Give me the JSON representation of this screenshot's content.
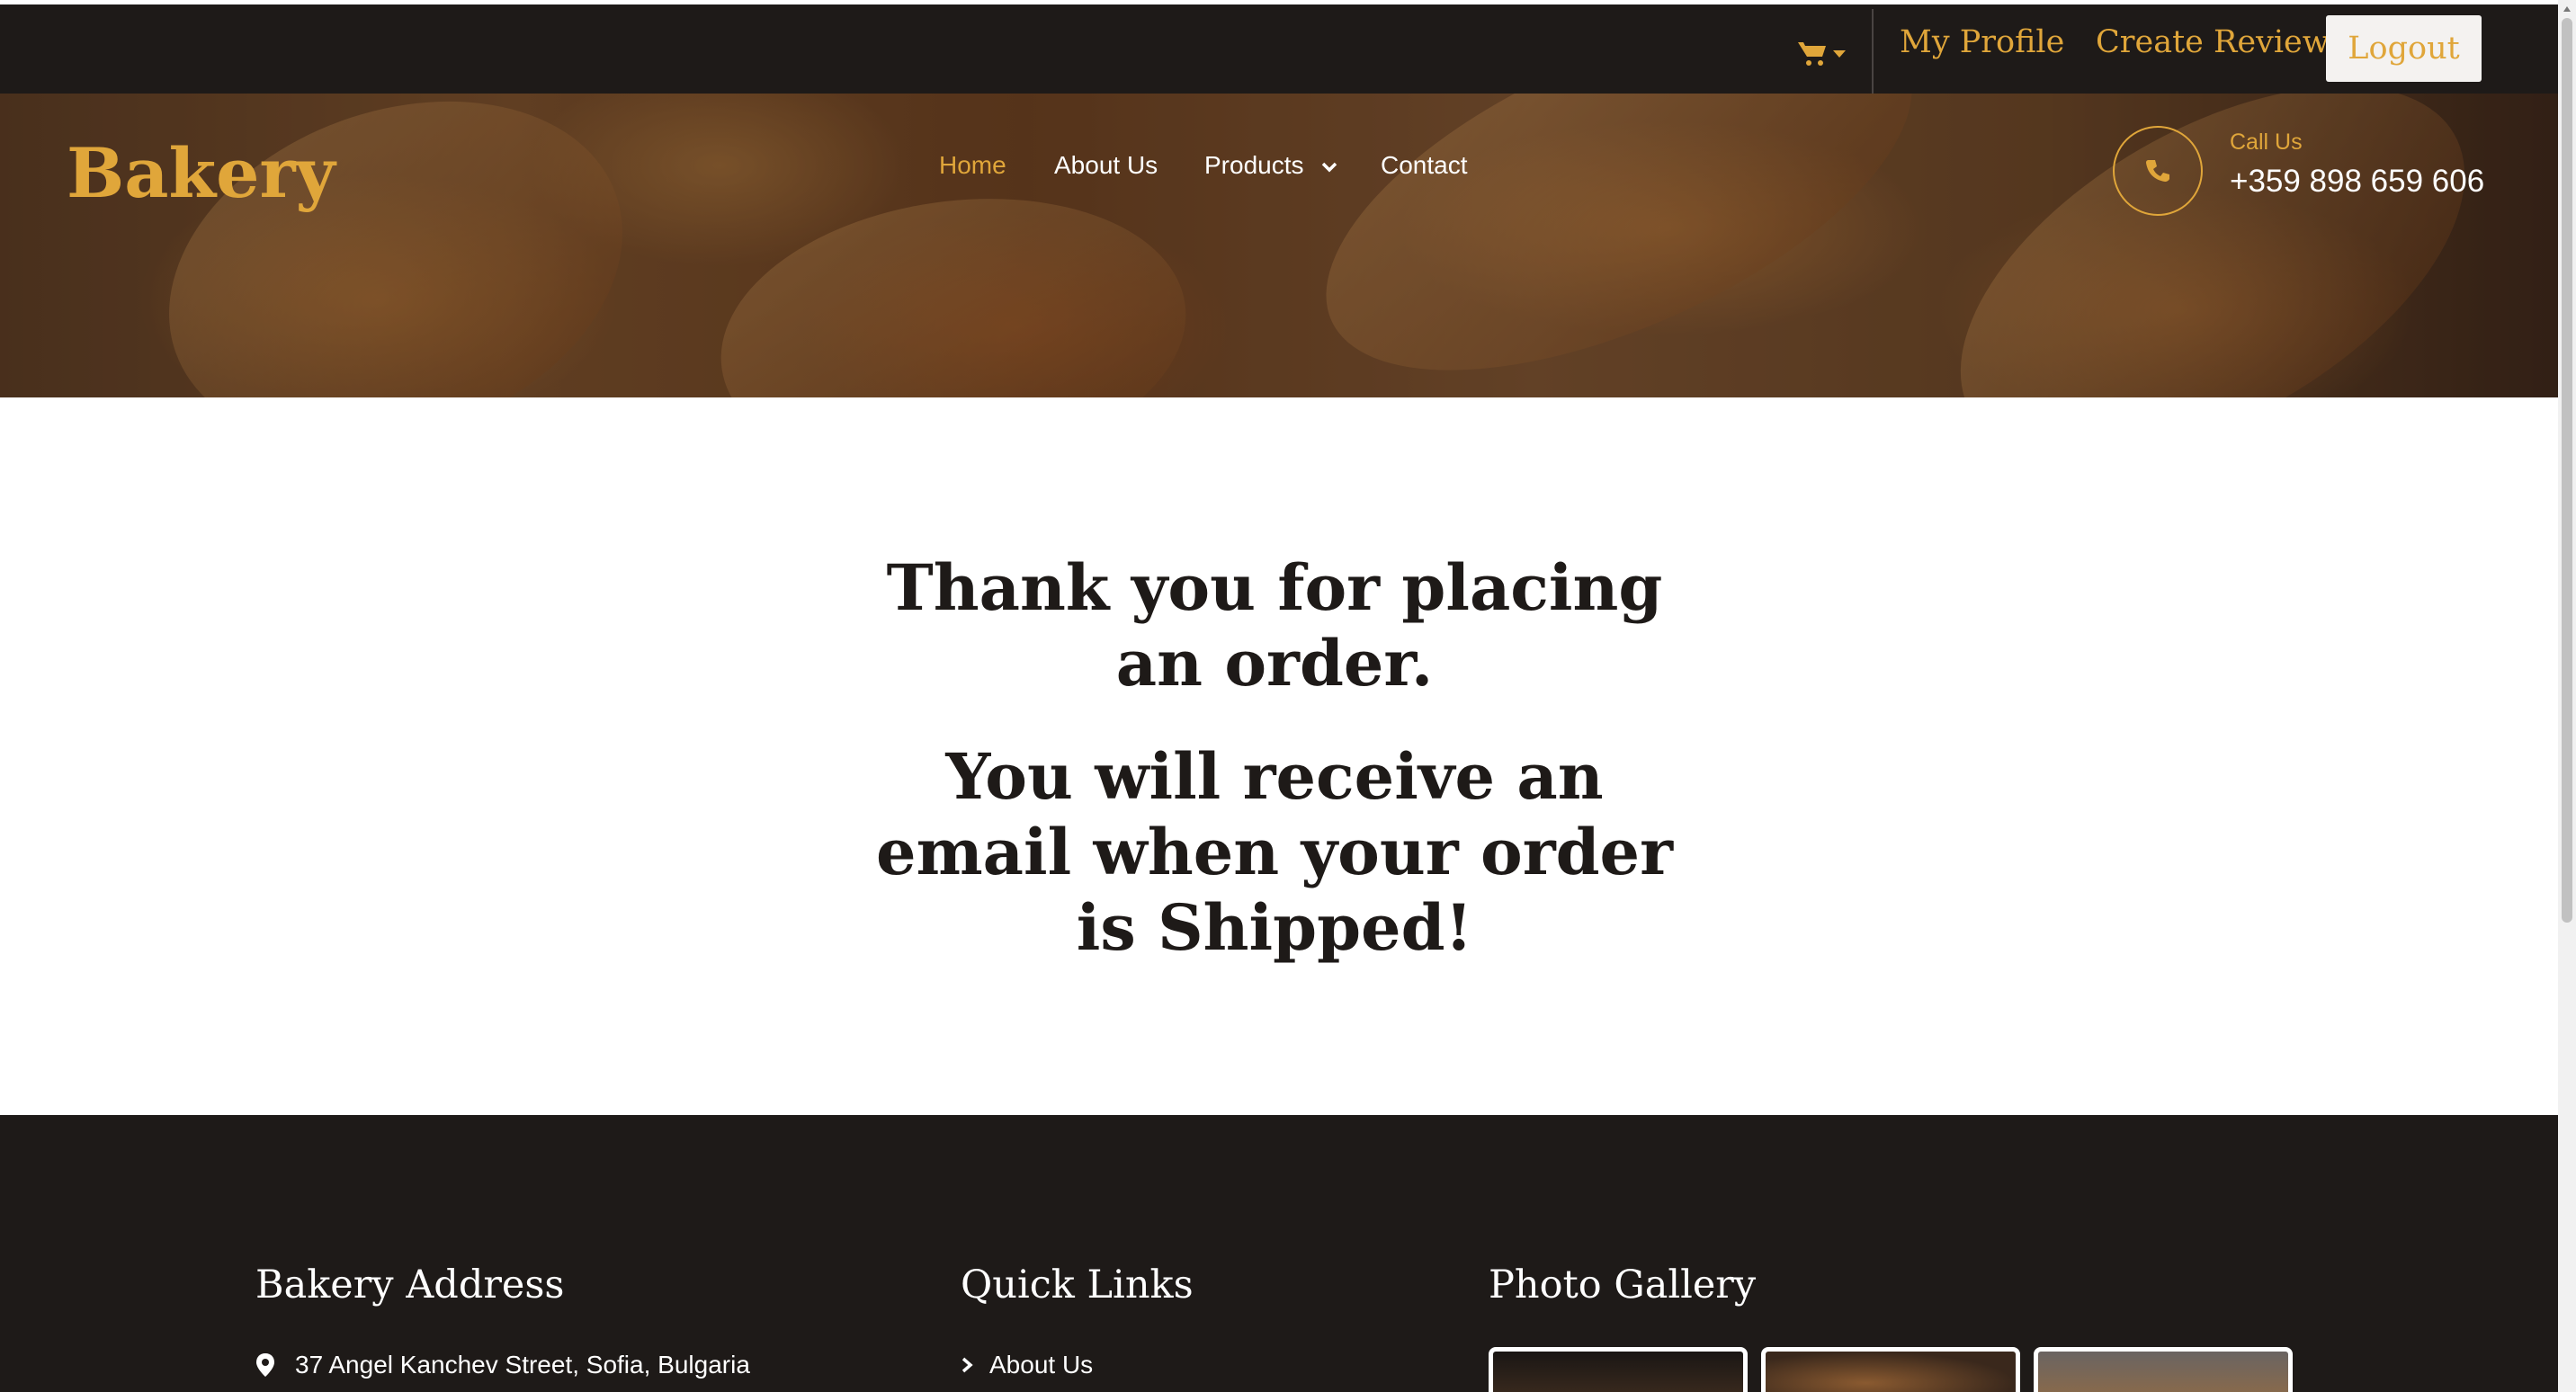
{
  "topbar": {
    "cart_icon": "shopping-cart-icon",
    "my_profile": "My Profile",
    "create_review": "Create Review",
    "logout": "Logout"
  },
  "header": {
    "brand": "Bakery",
    "nav": [
      {
        "label": "Home",
        "active": true
      },
      {
        "label": "About Us"
      },
      {
        "label": "Products",
        "has_dropdown": true
      },
      {
        "label": "Contact"
      }
    ],
    "call_label": "Call Us",
    "phone": "+359 898 659 606"
  },
  "main": {
    "line1": "Thank you for placing an order.",
    "line2": "You will receive an email when your order is Shipped!"
  },
  "footer": {
    "address_heading": "Bakery Address",
    "address": "37 Angel Kanchev Street, Sofia, Bulgaria",
    "links_heading": "Quick Links",
    "links": [
      "About Us"
    ],
    "gallery_heading": "Photo Gallery"
  },
  "colors": {
    "accent": "#e0a63a",
    "dark": "#1e1a18",
    "text_dark": "#1e1a18",
    "white": "#ffffff"
  }
}
